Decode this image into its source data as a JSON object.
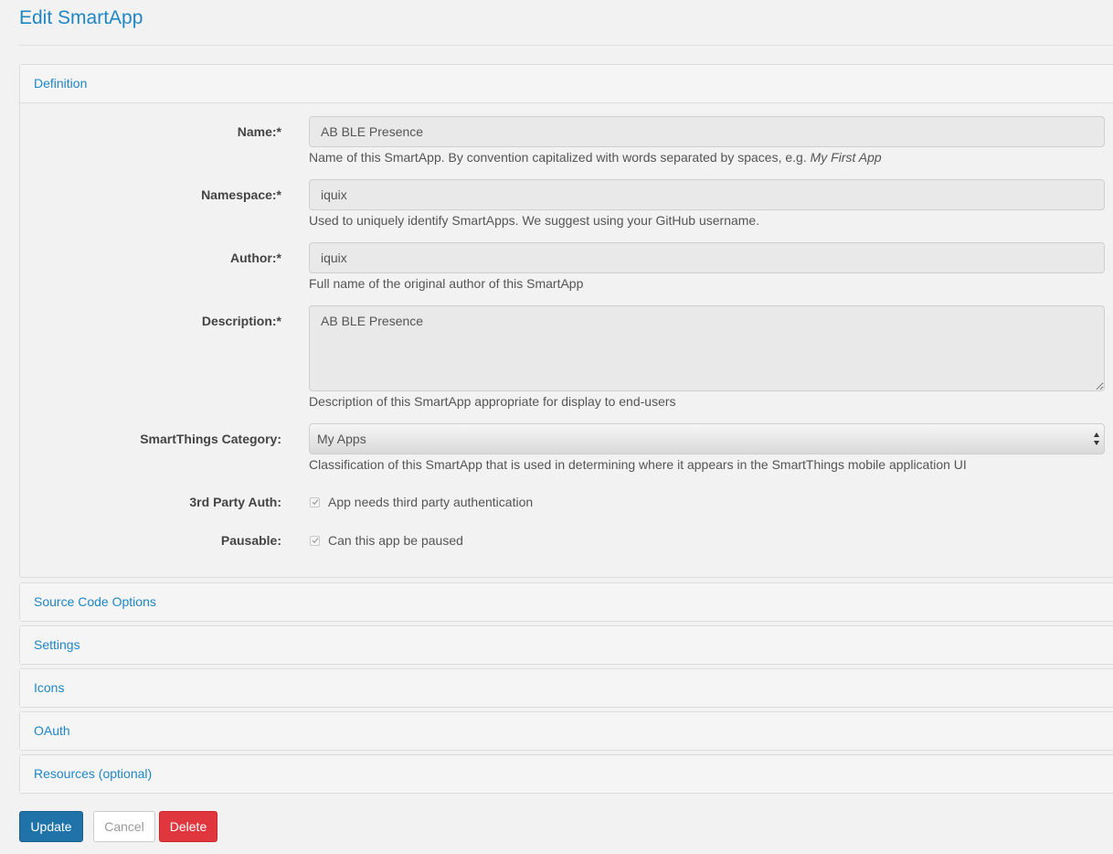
{
  "page": {
    "title": "Edit SmartApp"
  },
  "sections": {
    "definition": "Definition",
    "source_code": "Source Code Options",
    "settings": "Settings",
    "icons": "Icons",
    "oauth": "OAuth",
    "resources": "Resources (optional)"
  },
  "form": {
    "name": {
      "label": "Name:*",
      "value": "AB BLE Presence",
      "help": "Name of this SmartApp. By convention capitalized with words separated by spaces, e.g. ",
      "help_example": "My First App"
    },
    "namespace": {
      "label": "Namespace:*",
      "value": "iquix",
      "help": "Used to uniquely identify SmartApps. We suggest using your GitHub username."
    },
    "author": {
      "label": "Author:*",
      "value": "iquix",
      "help": "Full name of the original author of this SmartApp"
    },
    "description": {
      "label": "Description:*",
      "value": "AB BLE Presence",
      "help": "Description of this SmartApp appropriate for display to end-users"
    },
    "category": {
      "label": "SmartThings Category:",
      "selected": "My Apps",
      "help": "Classification of this SmartApp that is used in determining where it appears in the SmartThings mobile application UI"
    },
    "third_party_auth": {
      "label": "3rd Party Auth:",
      "option": "App needs third party authentication",
      "checked": true
    },
    "pausable": {
      "label": "Pausable:",
      "option": "Can this app be paused",
      "checked": true
    }
  },
  "actions": {
    "update": "Update",
    "cancel": "Cancel",
    "delete": "Delete"
  },
  "colors": {
    "link": "#1f86c4",
    "primary": "#1f73a8",
    "danger": "#e0363e",
    "background": "#f2f2f2"
  }
}
